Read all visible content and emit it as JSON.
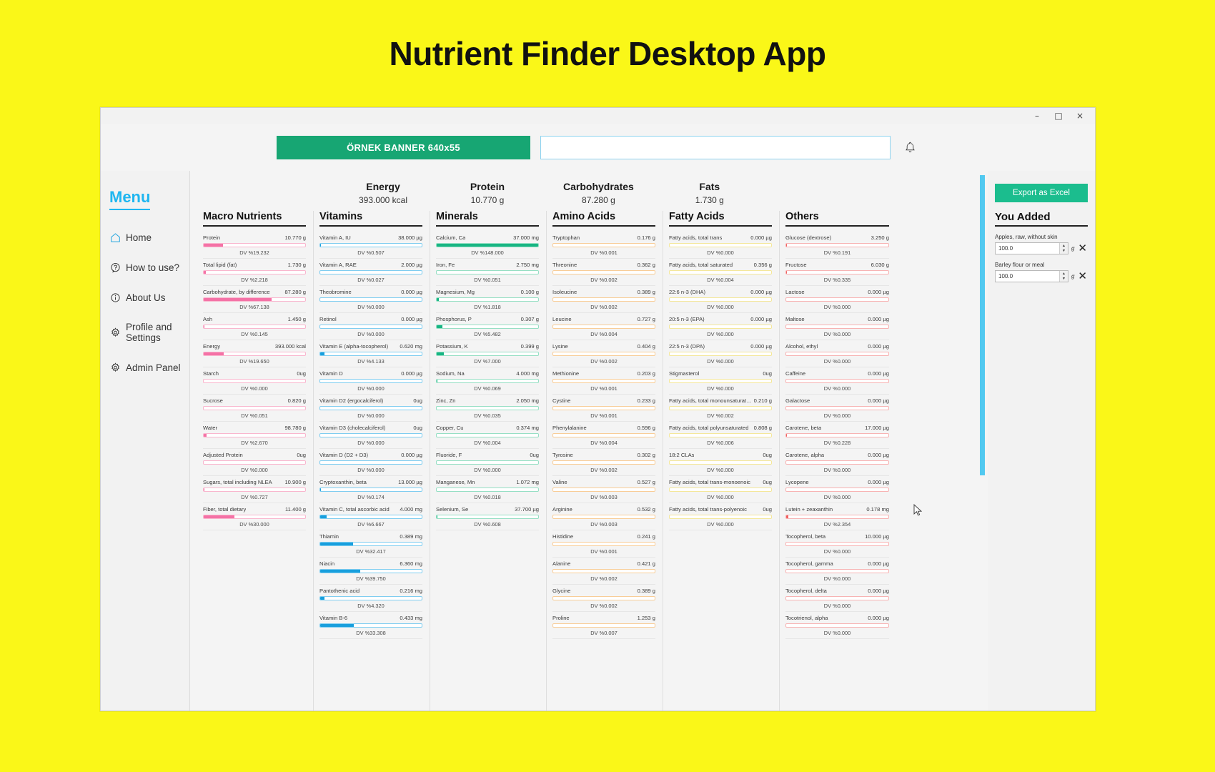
{
  "page": {
    "heading": "Nutrient Finder Desktop App",
    "background": "#FAF718"
  },
  "window": {
    "minimize": "–",
    "maximize": "□",
    "close": "×"
  },
  "topbar": {
    "banner_label": "ÖRNEK BANNER 640x55",
    "search_value": "",
    "search_placeholder": "",
    "bell_icon": "bell-icon"
  },
  "sidebar": {
    "title": "Menu",
    "items": [
      {
        "label": "Home",
        "icon": "home-icon"
      },
      {
        "label": "How to use?",
        "icon": "question-mark-icon"
      },
      {
        "label": "About Us",
        "icon": "info-icon"
      },
      {
        "label": "Profile and Settings",
        "icon": "gear-icon"
      },
      {
        "label": "Admin Panel",
        "icon": "gear-icon"
      }
    ]
  },
  "summary": [
    {
      "label": "Energy",
      "value": "393.000 kcal"
    },
    {
      "label": "Protein",
      "value": "10.770 g"
    },
    {
      "label": "Carbohydrates",
      "value": "87.280 g"
    },
    {
      "label": "Fats",
      "value": "1.730 g"
    }
  ],
  "right_panel": {
    "export_label": "Export as Excel",
    "added_title": "You Added",
    "items": [
      {
        "name": "Apples, raw, without skin",
        "amount": "100.0",
        "unit": "g",
        "remove": "✕"
      },
      {
        "name": "Barley flour or meal",
        "amount": "100.0",
        "unit": "g",
        "remove": "✕"
      }
    ]
  },
  "columns": [
    {
      "title": "Macro Nutrients",
      "palette": "p-pink",
      "rows": [
        {
          "name": "Protein",
          "value": "10.770 g",
          "dv": "DV %19.232",
          "pct": 19.232
        },
        {
          "name": "Total lipid (fat)",
          "value": "1.730 g",
          "dv": "DV %2.218",
          "pct": 2.218
        },
        {
          "name": "Carbohydrate, by difference",
          "value": "87.280 g",
          "dv": "DV %67.138",
          "pct": 67.138
        },
        {
          "name": "Ash",
          "value": "1.450 g",
          "dv": "DV %0.145",
          "pct": 0.145
        },
        {
          "name": "Energy",
          "value": "393.000 kcal",
          "dv": "DV %19.650",
          "pct": 19.65
        },
        {
          "name": "Starch",
          "value": "0ug",
          "dv": "DV %0.000",
          "pct": 0
        },
        {
          "name": "Sucrose",
          "value": "0.820 g",
          "dv": "DV %0.051",
          "pct": 0.051
        },
        {
          "name": "Water",
          "value": "98.780 g",
          "dv": "DV %2.670",
          "pct": 2.67
        },
        {
          "name": "Adjusted Protein",
          "value": "0ug",
          "dv": "DV %0.000",
          "pct": 0
        },
        {
          "name": "Sugars, total including NLEA",
          "value": "10.900 g",
          "dv": "DV %0.727",
          "pct": 0.727
        },
        {
          "name": "Fiber, total dietary",
          "value": "11.400 g",
          "dv": "DV %30.000",
          "pct": 30.0
        }
      ]
    },
    {
      "title": "Vitamins",
      "palette": "p-blue",
      "rows": [
        {
          "name": "Vitamin A, IU",
          "value": "38.000 µg",
          "dv": "DV %0.507",
          "pct": 0.507
        },
        {
          "name": "Vitamin A, RAE",
          "value": "2.000 µg",
          "dv": "DV %0.027",
          "pct": 0.027
        },
        {
          "name": "Theobromine",
          "value": "0.000 µg",
          "dv": "DV %0.000",
          "pct": 0
        },
        {
          "name": "Retinol",
          "value": "0.000 µg",
          "dv": "DV %0.000",
          "pct": 0
        },
        {
          "name": "Vitamin E (alpha-tocopherol)",
          "value": "0.620 mg",
          "dv": "DV %4.133",
          "pct": 4.133
        },
        {
          "name": "Vitamin D",
          "value": "0.000 µg",
          "dv": "DV %0.000",
          "pct": 0
        },
        {
          "name": "Vitamin D2 (ergocalciferol)",
          "value": "0ug",
          "dv": "DV %0.000",
          "pct": 0
        },
        {
          "name": "Vitamin D3 (cholecalciferol)",
          "value": "0ug",
          "dv": "DV %0.000",
          "pct": 0
        },
        {
          "name": "Vitamin D (D2 + D3)",
          "value": "0.000 µg",
          "dv": "DV %0.000",
          "pct": 0
        },
        {
          "name": "Cryptoxanthin, beta",
          "value": "13.000 µg",
          "dv": "DV %0.174",
          "pct": 0.174
        },
        {
          "name": "Vitamin C, total ascorbic acid",
          "value": "4.000 mg",
          "dv": "DV %6.667",
          "pct": 6.667
        },
        {
          "name": "Thiamin",
          "value": "0.389 mg",
          "dv": "DV %32.417",
          "pct": 32.417
        },
        {
          "name": "Niacin",
          "value": "6.360 mg",
          "dv": "DV %39.750",
          "pct": 39.75
        },
        {
          "name": "Pantothenic acid",
          "value": "0.216 mg",
          "dv": "DV %4.320",
          "pct": 4.32
        },
        {
          "name": "Vitamin B-6",
          "value": "0.433 mg",
          "dv": "DV %33.308",
          "pct": 33.308
        }
      ]
    },
    {
      "title": "Minerals",
      "palette": "p-green",
      "rows": [
        {
          "name": "Calcium, Ca",
          "value": "37.000 mg",
          "dv": "DV %148.000",
          "pct": 100
        },
        {
          "name": "Iron, Fe",
          "value": "2.750 mg",
          "dv": "DV %0.051",
          "pct": 0.051
        },
        {
          "name": "Magnesium, Mg",
          "value": "0.100 g",
          "dv": "DV %1.818",
          "pct": 1.818
        },
        {
          "name": "Phosphorus, P",
          "value": "0.307 g",
          "dv": "DV %5.482",
          "pct": 5.482
        },
        {
          "name": "Potassium, K",
          "value": "0.399 g",
          "dv": "DV %7.000",
          "pct": 7.0
        },
        {
          "name": "Sodium, Na",
          "value": "4.000 mg",
          "dv": "DV %0.069",
          "pct": 0.069
        },
        {
          "name": "Zinc, Zn",
          "value": "2.050 mg",
          "dv": "DV %0.035",
          "pct": 0.035
        },
        {
          "name": "Copper, Cu",
          "value": "0.374 mg",
          "dv": "DV %0.004",
          "pct": 0.004
        },
        {
          "name": "Fluoride, F",
          "value": "0ug",
          "dv": "DV %0.000",
          "pct": 0
        },
        {
          "name": "Manganese, Mn",
          "value": "1.072 mg",
          "dv": "DV %0.018",
          "pct": 0.018
        },
        {
          "name": "Selenium, Se",
          "value": "37.700 µg",
          "dv": "DV %0.608",
          "pct": 0.608
        }
      ]
    },
    {
      "title": "Amino Acids",
      "palette": "p-orange",
      "rows": [
        {
          "name": "Tryptophan",
          "value": "0.176 g",
          "dv": "DV %0.001",
          "pct": 0.001
        },
        {
          "name": "Threonine",
          "value": "0.362 g",
          "dv": "DV %0.002",
          "pct": 0.002
        },
        {
          "name": "Isoleucine",
          "value": "0.389 g",
          "dv": "DV %0.002",
          "pct": 0.002
        },
        {
          "name": "Leucine",
          "value": "0.727 g",
          "dv": "DV %0.004",
          "pct": 0.004
        },
        {
          "name": "Lysine",
          "value": "0.404 g",
          "dv": "DV %0.002",
          "pct": 0.002
        },
        {
          "name": "Methionine",
          "value": "0.203 g",
          "dv": "DV %0.001",
          "pct": 0.001
        },
        {
          "name": "Cystine",
          "value": "0.233 g",
          "dv": "DV %0.001",
          "pct": 0.001
        },
        {
          "name": "Phenylalanine",
          "value": "0.596 g",
          "dv": "DV %0.004",
          "pct": 0.004
        },
        {
          "name": "Tyrosine",
          "value": "0.302 g",
          "dv": "DV %0.002",
          "pct": 0.002
        },
        {
          "name": "Valine",
          "value": "0.527 g",
          "dv": "DV %0.003",
          "pct": 0.003
        },
        {
          "name": "Arginine",
          "value": "0.532 g",
          "dv": "DV %0.003",
          "pct": 0.003
        },
        {
          "name": "Histidine",
          "value": "0.241 g",
          "dv": "DV %0.001",
          "pct": 0.001
        },
        {
          "name": "Alanine",
          "value": "0.421 g",
          "dv": "DV %0.002",
          "pct": 0.002
        },
        {
          "name": "Glycine",
          "value": "0.389 g",
          "dv": "DV %0.002",
          "pct": 0.002
        },
        {
          "name": "Proline",
          "value": "1.253 g",
          "dv": "DV %0.007",
          "pct": 0.007
        }
      ]
    },
    {
      "title": "Fatty Acids",
      "palette": "p-yellow",
      "rows": [
        {
          "name": "Fatty acids, total trans",
          "value": "0.000 µg",
          "dv": "DV %0.000",
          "pct": 0
        },
        {
          "name": "Fatty acids, total saturated",
          "value": "0.356 g",
          "dv": "DV %0.004",
          "pct": 0.004
        },
        {
          "name": "22:6 n-3 (DHA)",
          "value": "0.000 µg",
          "dv": "DV %0.000",
          "pct": 0
        },
        {
          "name": "20:5 n-3 (EPA)",
          "value": "0.000 µg",
          "dv": "DV %0.000",
          "pct": 0
        },
        {
          "name": "22:5 n-3 (DPA)",
          "value": "0.000 µg",
          "dv": "DV %0.000",
          "pct": 0
        },
        {
          "name": "Stigmasterol",
          "value": "0ug",
          "dv": "DV %0.000",
          "pct": 0
        },
        {
          "name": "Fatty acids, total monounsaturated",
          "value": "0.210 g",
          "dv": "DV %0.002",
          "pct": 0.002
        },
        {
          "name": "Fatty acids, total polyunsaturated",
          "value": "0.808 g",
          "dv": "DV %0.006",
          "pct": 0.006
        },
        {
          "name": "18:2 CLAs",
          "value": "0ug",
          "dv": "DV %0.000",
          "pct": 0
        },
        {
          "name": "Fatty acids, total trans-monoenoic",
          "value": "0ug",
          "dv": "DV %0.000",
          "pct": 0
        },
        {
          "name": "Fatty acids, total trans-polyenoic",
          "value": "0ug",
          "dv": "DV %0.000",
          "pct": 0
        }
      ]
    },
    {
      "title": "Others",
      "palette": "p-red",
      "rows": [
        {
          "name": "Glucose (dextrose)",
          "value": "3.250 g",
          "dv": "DV %0.191",
          "pct": 0.191
        },
        {
          "name": "Fructose",
          "value": "6.030 g",
          "dv": "DV %0.335",
          "pct": 0.335
        },
        {
          "name": "Lactose",
          "value": "0.000 µg",
          "dv": "DV %0.000",
          "pct": 0
        },
        {
          "name": "Maltose",
          "value": "0.000 µg",
          "dv": "DV %0.000",
          "pct": 0
        },
        {
          "name": "Alcohol, ethyl",
          "value": "0.000 µg",
          "dv": "DV %0.000",
          "pct": 0
        },
        {
          "name": "Caffeine",
          "value": "0.000 µg",
          "dv": "DV %0.000",
          "pct": 0
        },
        {
          "name": "Galactose",
          "value": "0.000 µg",
          "dv": "DV %0.000",
          "pct": 0
        },
        {
          "name": "Carotene, beta",
          "value": "17.000 µg",
          "dv": "DV %0.228",
          "pct": 0.228
        },
        {
          "name": "Carotene, alpha",
          "value": "0.000 µg",
          "dv": "DV %0.000",
          "pct": 0
        },
        {
          "name": "Lycopene",
          "value": "0.000 µg",
          "dv": "DV %0.000",
          "pct": 0
        },
        {
          "name": "Lutein + zeaxanthin",
          "value": "0.178 mg",
          "dv": "DV %2.354",
          "pct": 2.354
        },
        {
          "name": "Tocopherol, beta",
          "value": "10.000 µg",
          "dv": "DV %0.000",
          "pct": 0
        },
        {
          "name": "Tocopherol, gamma",
          "value": "0.000 µg",
          "dv": "DV %0.000",
          "pct": 0
        },
        {
          "name": "Tocopherol, delta",
          "value": "0.000 µg",
          "dv": "DV %0.000",
          "pct": 0
        },
        {
          "name": "Tocotrienol, alpha",
          "value": "0.000 µg",
          "dv": "DV %0.000",
          "pct": 0
        }
      ]
    }
  ]
}
